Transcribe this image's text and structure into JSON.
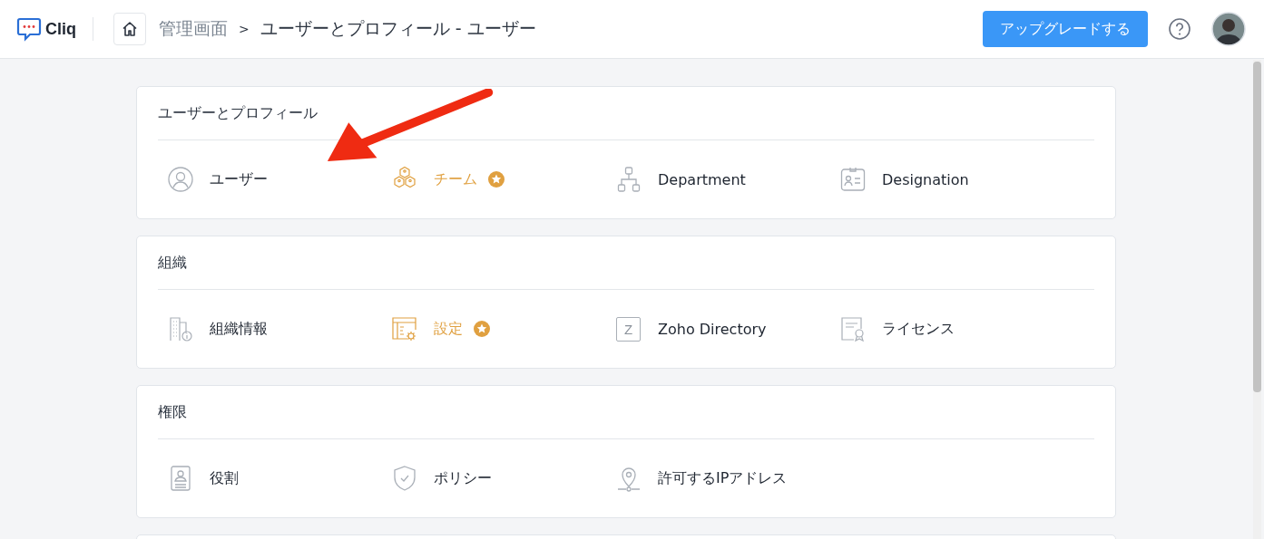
{
  "header": {
    "logo_text": "Cliq",
    "breadcrumb": [
      {
        "label": "管理画面",
        "kind": "link"
      },
      {
        "label": ">",
        "kind": "separator"
      },
      {
        "label": "ユーザーとプロフィール - ユーザー",
        "kind": "current"
      }
    ],
    "upgrade_button": "アップグレードする"
  },
  "sections": [
    {
      "title": "ユーザーとプロフィール",
      "items": [
        {
          "label": "ユーザー",
          "kind": "user",
          "premium": false
        },
        {
          "label": "チーム",
          "kind": "team",
          "premium": true
        },
        {
          "label": "Department",
          "kind": "org",
          "premium": false
        },
        {
          "label": "Designation",
          "kind": "idcard",
          "premium": false
        }
      ]
    },
    {
      "title": "組織",
      "items": [
        {
          "label": "組織情報",
          "kind": "building",
          "premium": false
        },
        {
          "label": "設定",
          "kind": "settings",
          "premium": true
        },
        {
          "label": "Zoho Directory",
          "kind": "letter",
          "icon_text": "Z",
          "premium": false
        },
        {
          "label": "ライセンス",
          "kind": "license",
          "premium": false
        }
      ]
    },
    {
      "title": "権限",
      "items": [
        {
          "label": "役割",
          "kind": "role",
          "premium": false
        },
        {
          "label": "ポリシー",
          "kind": "shield",
          "premium": false
        },
        {
          "label": "許可するIPアドレス",
          "kind": "pin",
          "premium": false
        }
      ]
    }
  ],
  "annotation": {
    "kind": "arrow"
  }
}
